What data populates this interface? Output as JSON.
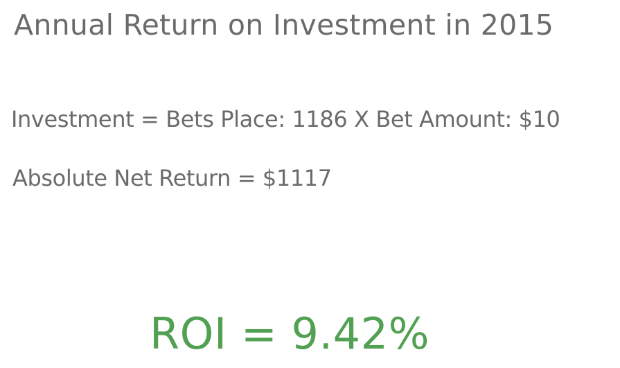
{
  "title": "Annual Return on Investment in 2015",
  "investment_line": "Investment = Bets Place: 1186  X  Bet Amount: $10",
  "net_return_line": "Absolute Net Return = $1117",
  "roi_line": "ROI = 9.42%",
  "colors": {
    "text": "#6b6b6b",
    "roi": "#52a052",
    "background": "#ffffff"
  }
}
